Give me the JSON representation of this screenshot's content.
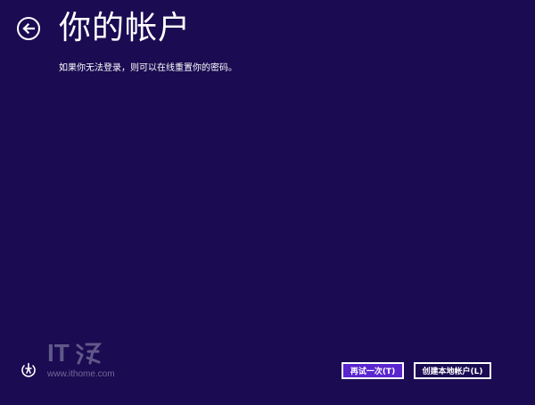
{
  "header": {
    "title": "你的帐户"
  },
  "main": {
    "description": "如果你无法登录，则可以在线重置你的密码。"
  },
  "buttons": {
    "retry_label": "再试一次(T)",
    "create_local_label": "创建本地帐户(L)"
  },
  "watermark": {
    "logo_text": "IT",
    "url": "www.ithome.com"
  },
  "icons": {
    "back": "arrow-left-icon",
    "ease_of_access": "ease-of-access-icon"
  },
  "colors": {
    "background": "#1a0b52",
    "primary_button": "#5a24cf",
    "text": "#ffffff"
  }
}
